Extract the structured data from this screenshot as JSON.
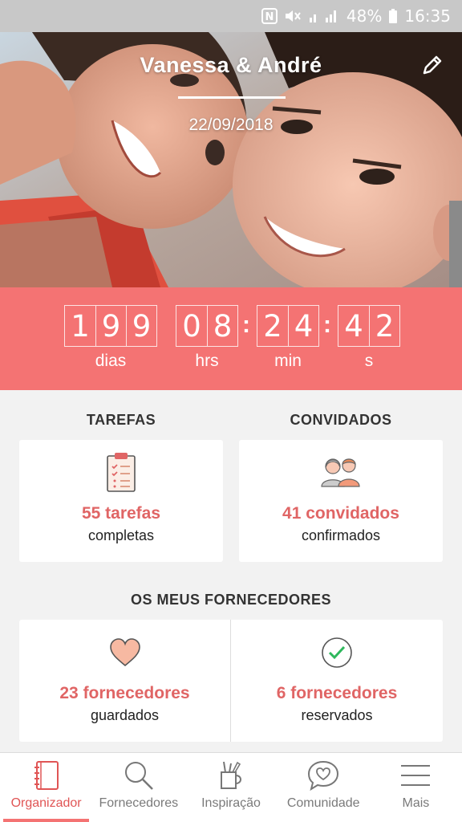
{
  "status_bar": {
    "battery": "48%",
    "time": "16:35"
  },
  "hero": {
    "names": "Vanessa & André",
    "date": "22/09/2018"
  },
  "countdown": {
    "days": [
      "1",
      "9",
      "9"
    ],
    "hours": [
      "0",
      "8"
    ],
    "minutes": [
      "2",
      "4"
    ],
    "seconds": [
      "4",
      "2"
    ],
    "days_label": "dias",
    "hours_label": "hrs",
    "minutes_label": "min",
    "seconds_label": "s",
    "separator": ":"
  },
  "tasks": {
    "title": "TAREFAS",
    "count": "55 tarefas",
    "status": "completas"
  },
  "guests": {
    "title": "CONVIDADOS",
    "count": "41 convidados",
    "status": "confirmados"
  },
  "vendors": {
    "title": "OS MEUS FORNECEDORES",
    "saved_count": "23 fornecedores",
    "saved_status": "guardados",
    "booked_count": "6 fornecedores",
    "booked_status": "reservados"
  },
  "nav": [
    {
      "label": "Organizador",
      "icon": "notebook-icon",
      "active": true
    },
    {
      "label": "Fornecedores",
      "icon": "search-icon",
      "active": false
    },
    {
      "label": "Inspiração",
      "icon": "pencil-cup-icon",
      "active": false
    },
    {
      "label": "Comunidade",
      "icon": "chat-heart-icon",
      "active": false
    },
    {
      "label": "Mais",
      "icon": "menu-icon",
      "active": false
    }
  ],
  "colors": {
    "accent": "#f47373",
    "accent_text": "#e06565"
  }
}
